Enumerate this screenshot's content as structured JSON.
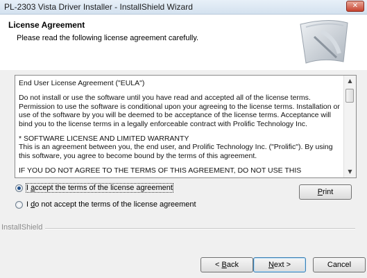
{
  "window": {
    "title": "PL-2303 Vista Driver Installer - InstallShield Wizard",
    "close_glyph": "✕"
  },
  "header": {
    "title": "License Agreement",
    "subtitle": "Please read the following license agreement carefully."
  },
  "license": {
    "paragraphs": [
      "End User License Agreement (\"EULA\")",
      "Do not install or use the software until you have read and accepted all of the license terms. Permission to use the software is conditional upon your agreeing to the license terms. Installation or use of the software by you will be deemed to be acceptance of the license terms. Acceptance will bind you to the license terms in a legally enforceable contract with Prolific Technology Inc.",
      "* SOFTWARE LICENSE AND LIMITED WARRANTY\nThis is an agreement between you, the end user, and Prolific Technology Inc. (\"Prolific\"). By using this software, you agree to become bound by the terms of this agreement.",
      "IF YOU DO NOT AGREE TO THE TERMS OF THIS AGREEMENT, DO NOT USE THIS"
    ],
    "scroll_up_glyph": "▲",
    "scroll_down_glyph": "▼"
  },
  "options": {
    "accept": {
      "mnemonic": "a",
      "before": "I ",
      "after": "ccept the terms of the license agreement",
      "selected": true
    },
    "decline": {
      "mnemonic": "d",
      "before": "I ",
      "after": "o not accept the terms of the license agreement",
      "selected": false
    }
  },
  "buttons": {
    "print": {
      "mnemonic": "P",
      "after": "rint"
    },
    "back": {
      "before": "< ",
      "mnemonic": "B",
      "after": "ack"
    },
    "next": {
      "mnemonic": "N",
      "after": "ext >"
    },
    "cancel": "Cancel"
  },
  "footer": {
    "brand": "InstallShield"
  },
  "colors": {
    "accent": "#1f4e8a",
    "close_button": "#c7432f"
  }
}
